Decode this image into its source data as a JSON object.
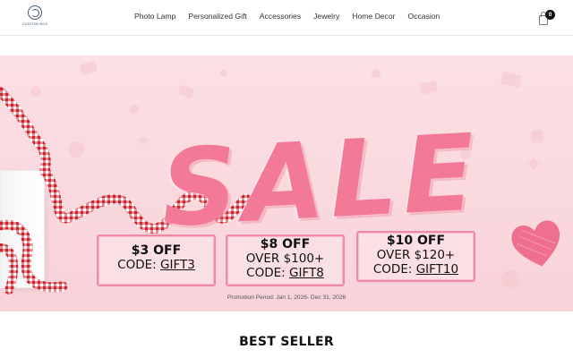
{
  "logo": {
    "text": "CUSTOM BOX"
  },
  "nav": {
    "items": [
      "Photo Lamp",
      "Personalized Gift",
      "Accessories",
      "Jewelry",
      "Home Decor",
      "Occasion"
    ]
  },
  "cart": {
    "count": "0"
  },
  "banner": {
    "headline": "SALE",
    "coupons": [
      {
        "amount": "$3 OFF",
        "condition": "",
        "code_label": "CODE:",
        "code": "GIFT3"
      },
      {
        "amount": "$8 OFF",
        "condition": "OVER $100+",
        "code_label": "CODE:",
        "code": "GIFT8"
      },
      {
        "amount": "$10 OFF",
        "condition": "OVER $120+",
        "code_label": "CODE:",
        "code": "GIFT10"
      }
    ],
    "promo_period": "Promotion Period: Jan 1, 2026- Dec 31, 2026"
  },
  "section": {
    "title": "BEST SELLER"
  },
  "colors": {
    "banner_bg": "#f8d3d9",
    "accent_pink": "#f27a97",
    "coupon_border": "#f08aa3",
    "ribbon_red": "#d8343c"
  }
}
